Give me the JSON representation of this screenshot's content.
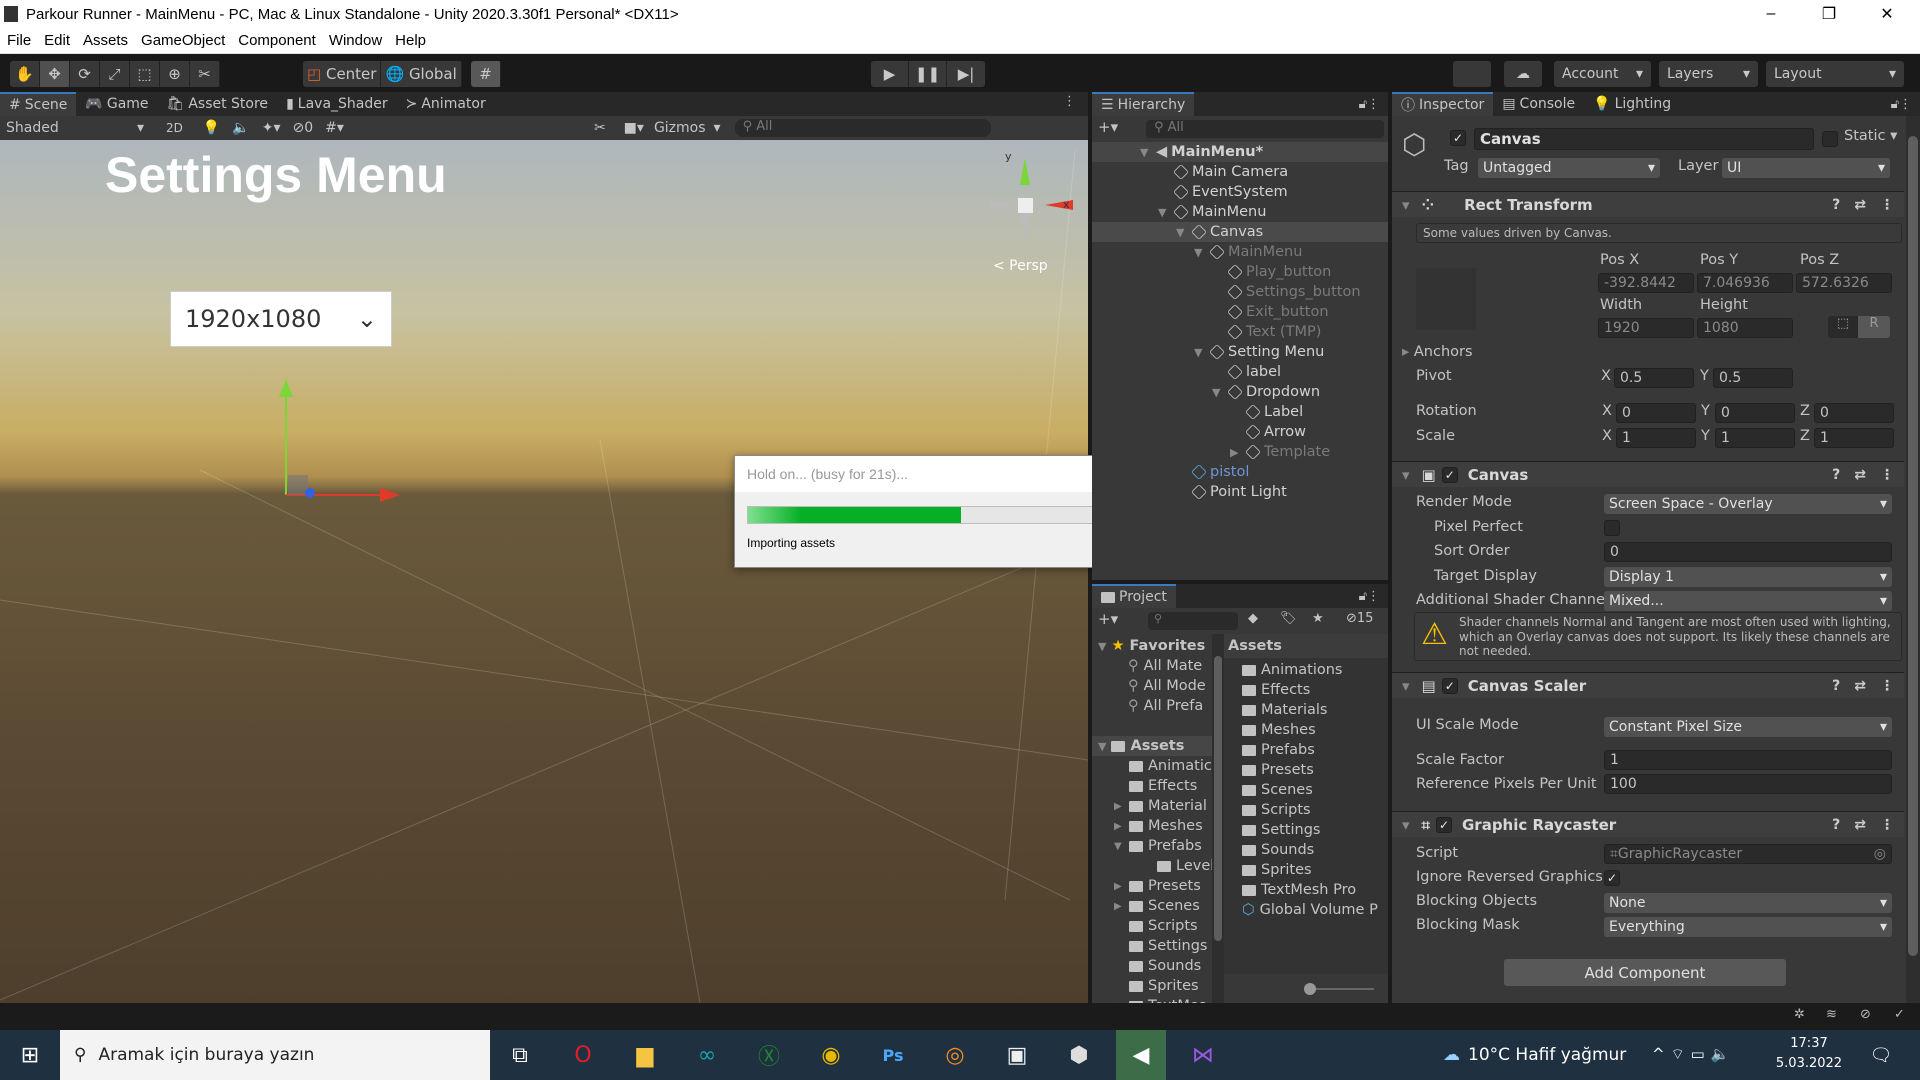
{
  "window": {
    "title": "Parkour Runner - MainMenu - PC, Mac & Linux Standalone - Unity 2020.3.30f1 Personal* <DX11>",
    "minimize": "–",
    "maximize": "❐",
    "close": "✕"
  },
  "menu": [
    "File",
    "Edit",
    "Assets",
    "GameObject",
    "Component",
    "Window",
    "Help"
  ],
  "toolbar": {
    "pivot": "Center",
    "space": "Global",
    "account": "Account",
    "layers": "Layers",
    "layout": "Layout"
  },
  "scene_tabs": [
    "Scene",
    "Game",
    "Asset Store",
    "Lava_Shader",
    "Animator"
  ],
  "scene_bar": {
    "shading": "Shaded",
    "mode2d": "2D",
    "hidden_count": "0",
    "gizmos": "Gizmos",
    "search_placeholder": "All"
  },
  "scene": {
    "heading": "Settings Menu",
    "dropdown_value": "1920x1080",
    "persp": "< Persp",
    "axis_y": "y",
    "axis_x": "x"
  },
  "dialog": {
    "title": "Hold on... (busy for 21s)...",
    "progress": 0.5,
    "status": "Importing assets",
    "progress_color": "#06b025"
  },
  "hierarchy": {
    "title": "Hierarchy",
    "search_placeholder": "All",
    "items": [
      {
        "label": "MainMenu*",
        "depth": 0,
        "state": "scene"
      },
      {
        "label": "Main Camera",
        "depth": 1,
        "state": "normal"
      },
      {
        "label": "EventSystem",
        "depth": 1,
        "state": "normal"
      },
      {
        "label": "MainMenu",
        "depth": 1,
        "state": "normal"
      },
      {
        "label": "Canvas",
        "depth": 2,
        "state": "selected"
      },
      {
        "label": "MainMenu",
        "depth": 3,
        "state": "inactive"
      },
      {
        "label": "Play_button",
        "depth": 4,
        "state": "inactive"
      },
      {
        "label": "Settings_button",
        "depth": 4,
        "state": "inactive"
      },
      {
        "label": "Exit_button",
        "depth": 4,
        "state": "inactive"
      },
      {
        "label": "Text (TMP)",
        "depth": 4,
        "state": "inactive"
      },
      {
        "label": "Setting Menu",
        "depth": 3,
        "state": "normal"
      },
      {
        "label": "label",
        "depth": 4,
        "state": "normal"
      },
      {
        "label": "Dropdown",
        "depth": 4,
        "state": "normal"
      },
      {
        "label": "Label",
        "depth": 5,
        "state": "normal"
      },
      {
        "label": "Arrow",
        "depth": 5,
        "state": "normal"
      },
      {
        "label": "Template",
        "depth": 5,
        "state": "inactive"
      },
      {
        "label": "pistol",
        "depth": 2,
        "state": "prefab"
      },
      {
        "label": "Point Light",
        "depth": 2,
        "state": "normal"
      }
    ]
  },
  "project": {
    "title": "Project",
    "hidden_count": "15",
    "favorites_label": "Favorites",
    "favorites": [
      "All Mate",
      "All Mode",
      "All Prefa"
    ],
    "assets_label": "Assets",
    "tree": [
      "Animatic",
      "Effects",
      "Material",
      "Meshes",
      "Prefabs",
      "Level:",
      "Presets",
      "Scenes",
      "Scripts",
      "Settings",
      "Sounds",
      "Sprites",
      "TextMes"
    ],
    "grid_header": "Assets",
    "grid": [
      "Animations",
      "Effects",
      "Materials",
      "Meshes",
      "Prefabs",
      "Presets",
      "Scenes",
      "Scripts",
      "Settings",
      "Sounds",
      "Sprites",
      "TextMesh Pro",
      "Global Volume P"
    ]
  },
  "inspector_tabs": [
    "Inspector",
    "Console",
    "Lighting"
  ],
  "inspector": {
    "object_name": "Canvas",
    "static_label": "Static",
    "tag_label": "Tag",
    "tag": "Untagged",
    "layer_label": "Layer",
    "layer": "UI",
    "rect": {
      "title": "Rect Transform",
      "note": "Some values driven by Canvas.",
      "pos_x_label": "Pos X",
      "pos_y_label": "Pos Y",
      "pos_z_label": "Pos Z",
      "pos_x": "-392.8442",
      "pos_y": "7.046936",
      "pos_z": "572.6326",
      "width_label": "Width",
      "height_label": "Height",
      "width": "1920",
      "height": "1080",
      "r_btn": "R",
      "anchors": "Anchors",
      "pivot": "Pivot",
      "pivot_x": "0.5",
      "pivot_y": "0.5",
      "rotation": "Rotation",
      "rot": [
        "0",
        "0",
        "0"
      ],
      "scale": "Scale",
      "scl": [
        "1",
        "1",
        "1"
      ],
      "x": "X",
      "y": "Y",
      "z": "Z"
    },
    "canvas": {
      "title": "Canvas",
      "render_mode_label": "Render Mode",
      "render_mode": "Screen Space - Overlay",
      "pixel_perfect_label": "Pixel Perfect",
      "sort_order_label": "Sort Order",
      "sort_order": "0",
      "target_display_label": "Target Display",
      "target_display": "Display 1",
      "shader_label": "Additional Shader Channe",
      "shader": "Mixed...",
      "warning": "Shader channels Normal and Tangent are most often used with lighting, which an Overlay canvas does not support. Its likely these channels are not needed."
    },
    "scaler": {
      "title": "Canvas Scaler",
      "mode_label": "UI Scale Mode",
      "mode": "Constant Pixel Size",
      "factor_label": "Scale Factor",
      "factor": "1",
      "ppu_label": "Reference Pixels Per Unit",
      "ppu": "100"
    },
    "raycaster": {
      "title": "Graphic Raycaster",
      "script_label": "Script",
      "script": "GraphicRaycaster",
      "ignore_label": "Ignore Reversed Graphics",
      "blocking_objects_label": "Blocking Objects",
      "blocking_objects": "None",
      "blocking_mask_label": "Blocking Mask",
      "blocking_mask": "Everything"
    },
    "add_component": "Add Component"
  },
  "taskbar": {
    "search_placeholder": "Aramak için buraya yazın",
    "weather": "10°C  Hafif yağmur",
    "time": "17:37",
    "date": "5.03.2022"
  }
}
